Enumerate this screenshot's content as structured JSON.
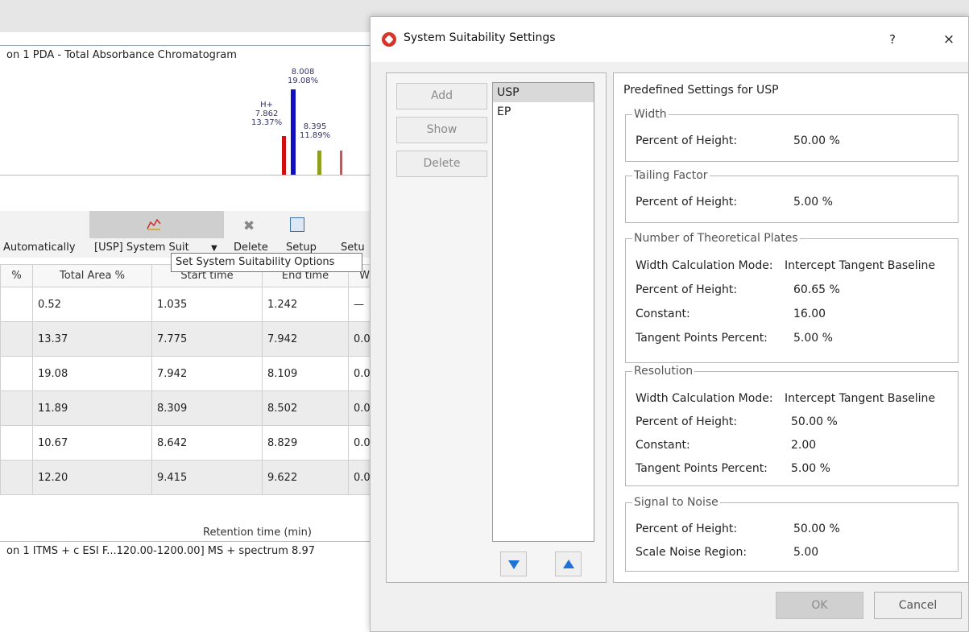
{
  "background": {
    "chromatogram_title": "on 1  PDA - Total Absorbance Chromatogram",
    "peaks": [
      {
        "time": "8.008",
        "pct": "19.08%"
      },
      {
        "ion": "H+",
        "time": "7.862",
        "pct": "13.37%"
      },
      {
        "time": "8.395",
        "pct": "11.89%"
      }
    ],
    "toolbar": {
      "auto_label": "Automatically",
      "system_suit_label": "[USP] System Suit",
      "delete_label": "Delete",
      "setup_label": "Setup",
      "setup2_label": "Setu",
      "tooltip": "Set System Suitability Options"
    },
    "table": {
      "headers": [
        "%",
        "Total Area %",
        "Start time",
        "End time",
        "W"
      ],
      "rows": [
        [
          "0.52",
          "1.035",
          "1.242",
          "—"
        ],
        [
          "13.37",
          "7.775",
          "7.942",
          "0.0"
        ],
        [
          "19.08",
          "7.942",
          "8.109",
          "0.0"
        ],
        [
          "11.89",
          "8.309",
          "8.502",
          "0.0"
        ],
        [
          "10.67",
          "8.642",
          "8.829",
          "0.0"
        ],
        [
          "12.20",
          "9.415",
          "9.622",
          "0.0"
        ]
      ]
    },
    "retention_label": "Retention time (min)",
    "ms_header": "on 1 ITMS + c ESI F...120.00-1200.00] MS + spectrum 8.97"
  },
  "dialog": {
    "title": "System Suitability Settings",
    "help": "?",
    "close": "×",
    "buttons": {
      "add": "Add",
      "show": "Show",
      "delete": "Delete"
    },
    "list": [
      "USP",
      "EP"
    ],
    "panel_title": "Predefined Settings for USP",
    "width_group": {
      "label": "Width",
      "percent_label": "Percent of Height:",
      "percent_value": "50.00 %"
    },
    "tailing_group": {
      "label": "Tailing Factor",
      "percent_label": "Percent of Height:",
      "percent_value": "5.00 %"
    },
    "plates_group": {
      "label": "Number of Theoretical Plates",
      "mode_label": "Width Calculation Mode:",
      "mode_value": "Intercept Tangent Baseline",
      "percent_label": "Percent of Height:",
      "percent_value": "60.65 %",
      "constant_label": "Constant:",
      "constant_value": "16.00",
      "tangent_label": "Tangent Points Percent:",
      "tangent_value": "5.00 %"
    },
    "resolution_group": {
      "label": "Resolution",
      "mode_label": "Width Calculation Mode:",
      "mode_value": "Intercept Tangent Baseline",
      "percent_label": "Percent of Height:",
      "percent_value": "50.00 %",
      "constant_label": "Constant:",
      "constant_value": "2.00",
      "tangent_label": "Tangent Points Percent:",
      "tangent_value": "5.00 %"
    },
    "noise_group": {
      "label": "Signal to Noise",
      "percent_label": "Percent of Height:",
      "percent_value": "50.00 %",
      "scale_label": "Scale Noise Region:",
      "scale_value": "5.00"
    },
    "ok": "OK",
    "cancel": "Cancel"
  }
}
